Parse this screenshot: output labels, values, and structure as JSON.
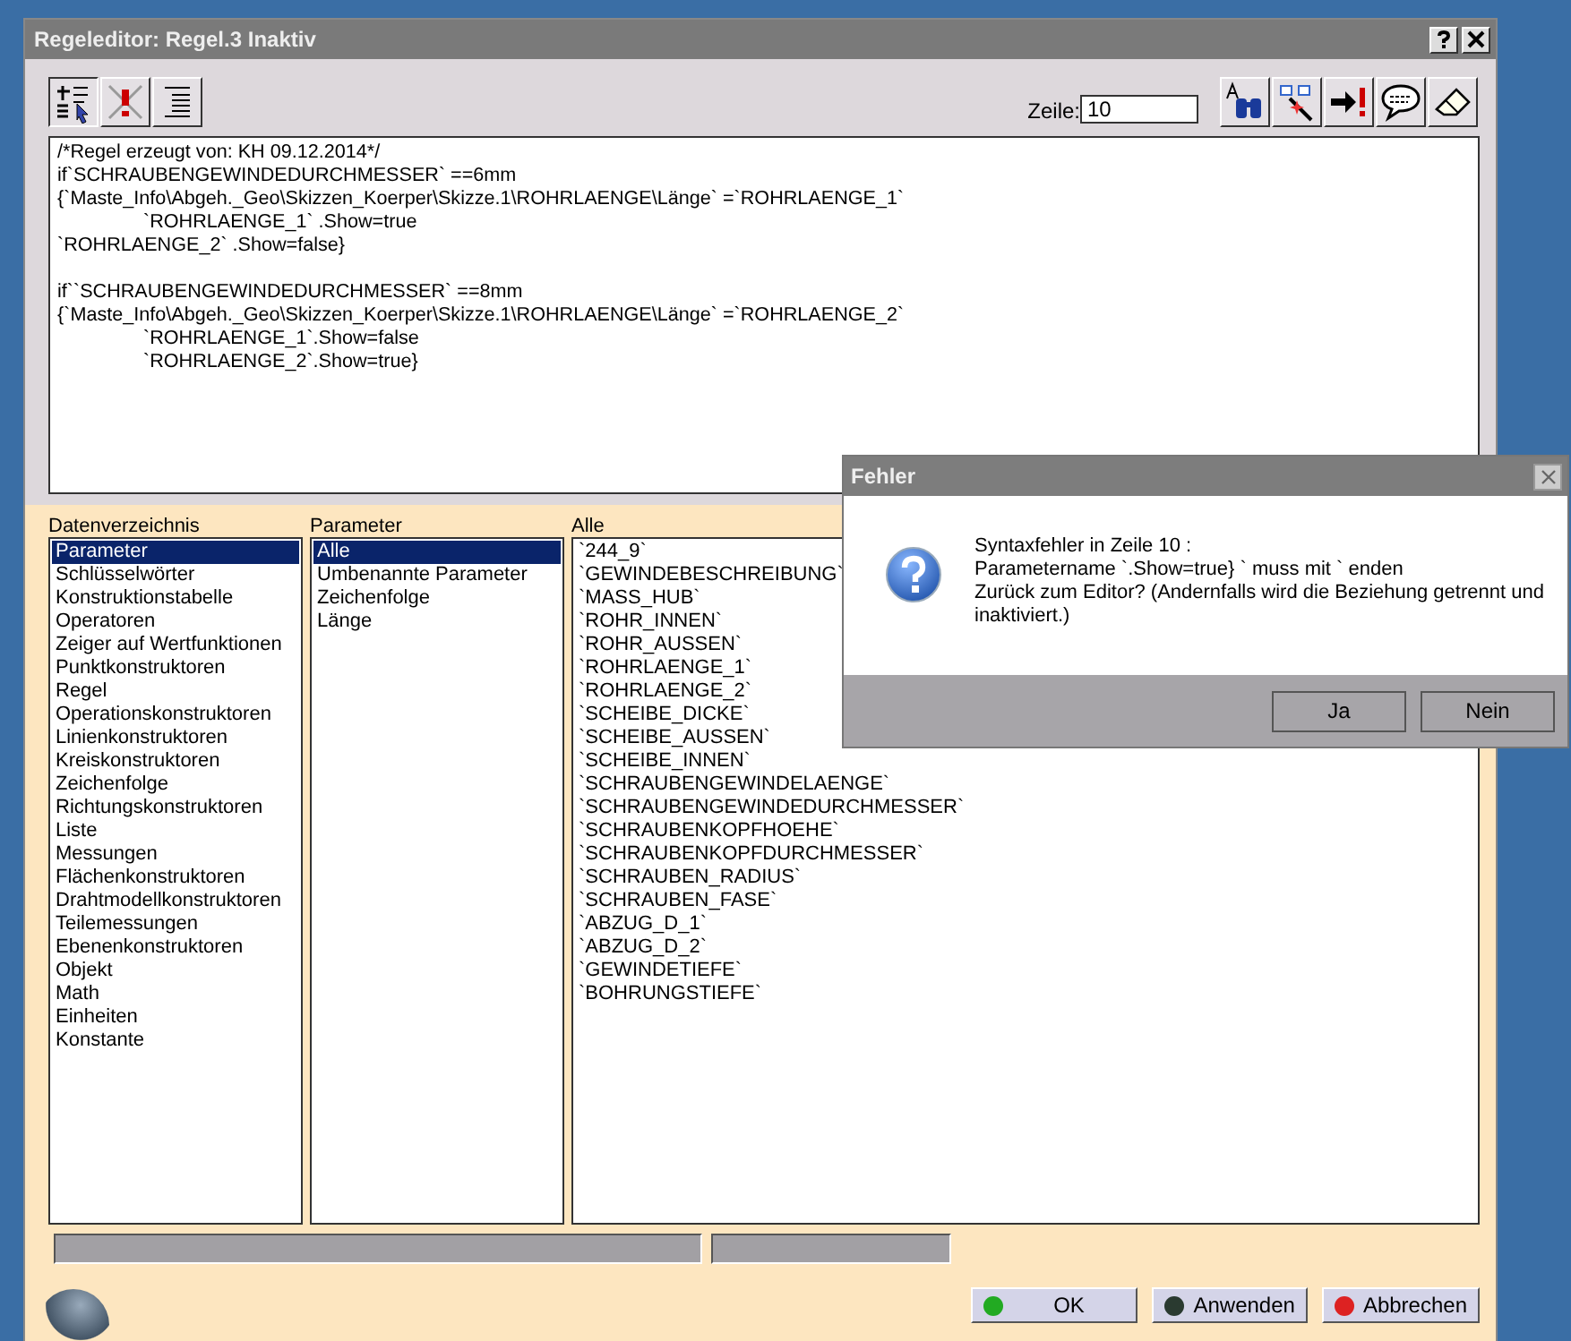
{
  "window": {
    "title": "Regeleditor: Regel.3 Inaktiv"
  },
  "line_field": {
    "label": "Zeile:",
    "value": "10"
  },
  "editor": {
    "blocks": [
      [
        {
          "text": "/*Regel erzeugt von: KH 09.12.2014*/",
          "indent": false
        },
        {
          "text": "if`SCHRAUBENGEWINDEDURCHMESSER` ==6mm",
          "indent": false
        },
        {
          "text": "{`Maste_Info\\Abgeh._Geo\\Skizzen_Koerper\\Skizze.1\\ROHRLAENGE\\Länge` =`ROHRLAENGE_1`",
          "indent": false
        },
        {
          "text": "`ROHRLAENGE_1` .Show=true",
          "indent": true
        },
        {
          "text": "`ROHRLAENGE_2` .Show=false}",
          "indent": false
        }
      ],
      [
        {
          "text": "if``SCHRAUBENGEWINDEDURCHMESSER` ==8mm",
          "indent": false
        },
        {
          "text": "{`Maste_Info\\Abgeh._Geo\\Skizzen_Koerper\\Skizze.1\\ROHRLAENGE\\Länge` =`ROHRLAENGE_2`",
          "indent": false
        },
        {
          "text": "`ROHRLAENGE_1`.Show=false",
          "indent": true
        },
        {
          "text": "`ROHRLAENGE_2`.Show=true}",
          "indent": true
        }
      ]
    ]
  },
  "lists": [
    {
      "header": "Datenverzeichnis",
      "items": [
        {
          "label": "Parameter",
          "selected": true
        },
        {
          "label": "Schlüsselwörter",
          "selected": false
        },
        {
          "label": "Konstruktionstabelle",
          "selected": false
        },
        {
          "label": "Operatoren",
          "selected": false
        },
        {
          "label": "Zeiger auf Wertfunktionen",
          "selected": false
        },
        {
          "label": "Punktkonstruktoren",
          "selected": false
        },
        {
          "label": "Regel",
          "selected": false
        },
        {
          "label": "Operationskonstruktoren",
          "selected": false
        },
        {
          "label": "Linienkonstruktoren",
          "selected": false
        },
        {
          "label": "Kreiskonstruktoren",
          "selected": false
        },
        {
          "label": "Zeichenfolge",
          "selected": false
        },
        {
          "label": "Richtungskonstruktoren",
          "selected": false
        },
        {
          "label": "Liste",
          "selected": false
        },
        {
          "label": "Messungen",
          "selected": false
        },
        {
          "label": "Flächenkonstruktoren",
          "selected": false
        },
        {
          "label": "Drahtmodellkonstruktoren",
          "selected": false
        },
        {
          "label": "Teilemessungen",
          "selected": false
        },
        {
          "label": "Ebenenkonstruktoren",
          "selected": false
        },
        {
          "label": "Objekt",
          "selected": false
        },
        {
          "label": "Math",
          "selected": false
        },
        {
          "label": "Einheiten",
          "selected": false
        },
        {
          "label": "Konstante",
          "selected": false
        }
      ]
    },
    {
      "header": "Parameter",
      "items": [
        {
          "label": "Alle",
          "selected": true
        },
        {
          "label": "Umbenannte Parameter",
          "selected": false
        },
        {
          "label": "Zeichenfolge",
          "selected": false
        },
        {
          "label": "Länge",
          "selected": false
        }
      ]
    },
    {
      "header": "Alle",
      "items": [
        {
          "label": "`244_9`",
          "selected": false
        },
        {
          "label": "`GEWINDEBESCHREIBUNG`",
          "selected": false
        },
        {
          "label": "`MASS_HUB`",
          "selected": false
        },
        {
          "label": "`ROHR_INNEN`",
          "selected": false
        },
        {
          "label": "`ROHR_AUSSEN`",
          "selected": false
        },
        {
          "label": "`ROHRLAENGE_1`",
          "selected": false
        },
        {
          "label": "`ROHRLAENGE_2`",
          "selected": false
        },
        {
          "label": "`SCHEIBE_DICKE`",
          "selected": false
        },
        {
          "label": "`SCHEIBE_AUSSEN`",
          "selected": false
        },
        {
          "label": "`SCHEIBE_INNEN`",
          "selected": false
        },
        {
          "label": "`SCHRAUBENGEWINDELAENGE`",
          "selected": false
        },
        {
          "label": "`SCHRAUBENGEWINDEDURCHMESSER`",
          "selected": false
        },
        {
          "label": "`SCHRAUBENKOPFHOEHE`",
          "selected": false
        },
        {
          "label": "`SCHRAUBENKOPFDURCHMESSER`",
          "selected": false
        },
        {
          "label": "`SCHRAUBEN_RADIUS`",
          "selected": false
        },
        {
          "label": "`SCHRAUBEN_FASE`",
          "selected": false
        },
        {
          "label": "`ABZUG_D_1`",
          "selected": false
        },
        {
          "label": "`ABZUG_D_2`",
          "selected": false
        },
        {
          "label": "`GEWINDETIEFE`",
          "selected": false
        },
        {
          "label": "`BOHRUNGSTIEFE`",
          "selected": false
        }
      ]
    }
  ],
  "buttons": [
    {
      "label": "OK",
      "color": "#22aa22"
    },
    {
      "label": "Anwenden",
      "color": "#2a3a30"
    },
    {
      "label": "Abbrechen",
      "color": "#dd2222"
    }
  ],
  "error_dialog": {
    "title": "Fehler",
    "lines": [
      "Syntaxfehler in Zeile 10 :",
      " Parametername `.Show=true} ` muss mit ` enden",
      "Zurück zum Editor? (Andernfalls wird die Beziehung getrennt und inaktiviert.)"
    ],
    "buttons": [
      "Ja",
      "Nein"
    ]
  }
}
